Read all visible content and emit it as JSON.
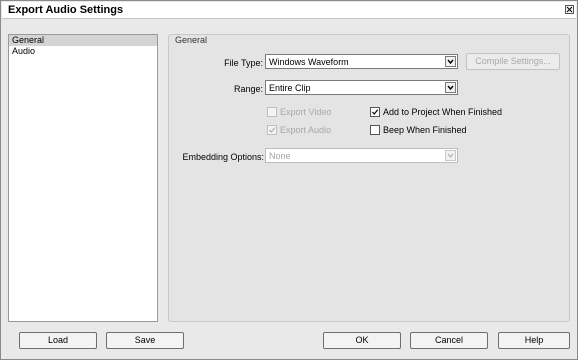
{
  "window": {
    "title": "Export Audio Settings"
  },
  "sidebar": {
    "items": [
      {
        "label": "General"
      },
      {
        "label": "Audio"
      }
    ]
  },
  "general": {
    "group_title": "General",
    "file_type": {
      "label": "File Type:",
      "value": "Windows Waveform"
    },
    "compile_settings_label": "Compile Settings...",
    "range": {
      "label": "Range:",
      "value": "Entire Clip"
    },
    "export_video": {
      "label": "Export Video",
      "checked": false,
      "enabled": false
    },
    "export_audio": {
      "label": "Export Audio",
      "checked": true,
      "enabled": false
    },
    "add_to_project": {
      "label": "Add to Project When Finished",
      "checked": true
    },
    "beep_when_finished": {
      "label": "Beep When Finished",
      "checked": false
    },
    "embedding": {
      "label": "Embedding Options:",
      "value": "None"
    }
  },
  "footer": {
    "load_label": "Load",
    "save_label": "Save",
    "ok_label": "OK",
    "cancel_label": "Cancel",
    "help_label": "Help"
  },
  "icons": {
    "close": "close-icon",
    "dropdown": "chevron-down-icon",
    "checkmark": "checkmark-icon"
  }
}
